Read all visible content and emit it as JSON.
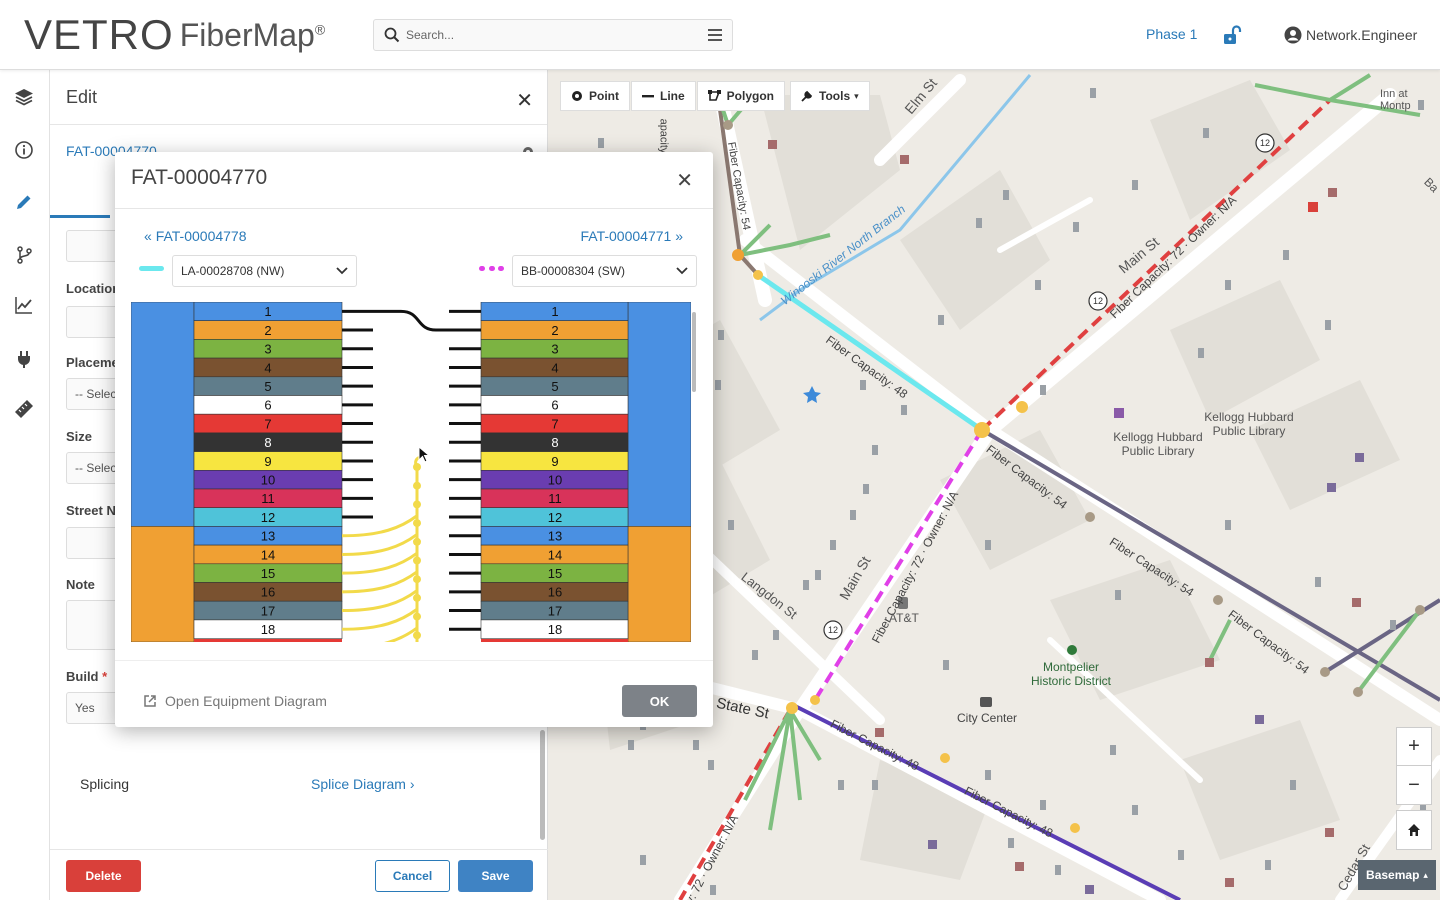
{
  "header": {
    "logo_main": "VETRO",
    "logo_product": "FiberMap",
    "logo_reg": "®",
    "search_placeholder": "Search...",
    "phase": "Phase 1",
    "user": "Network.Engineer"
  },
  "edit_panel": {
    "title": "Edit",
    "feature_id": "FAT-00004770",
    "labels": {
      "location": "Location",
      "placement": "Placeme",
      "size": "Size",
      "street": "Street N",
      "note": "Note",
      "build": "Build"
    },
    "placement_value": "-- Selec",
    "size_value": "-- Selec",
    "build_value": "Yes",
    "splicing_label": "Splicing",
    "splice_diagram_link": "Splice Diagram",
    "buttons": {
      "delete": "Delete",
      "cancel": "Cancel",
      "save": "Save"
    }
  },
  "map_tools": {
    "point": "Point",
    "line": "Line",
    "polygon": "Polygon",
    "tools": "Tools"
  },
  "map_labels": {
    "elm": "Elm St",
    "main_top": "Main St",
    "main_bottom": "Main St",
    "langdon": "Langdon St",
    "state": "State St",
    "cedar": "Cedar St",
    "river": "Winooski River North Branch",
    "fc48_a": "Fiber Capacity: 48",
    "fc48_b": "Fiber Capacity: 48",
    "fc48_c": "Fiber Capacity: 48",
    "fc54_a": "Fiber Capacity: 54",
    "fc54_b": "Fiber Capacity: 54",
    "fc54_c": "Fiber Capacity: 54",
    "fc72_top": "Fiber Capacity: 72 · Owner: N/A",
    "fc72_mid": "Fiber Capacity: 72 · Owner: N/A",
    "fc72_bot": "ity: 72 · Owner: N/A",
    "fc_vert": "Fiber Capacity: 54",
    "capacity_top": "apacity",
    "library1": "Kellogg Hubbard Public Library",
    "library2": "Kellogg Hubbard Public Library",
    "inn": "Inn at Montp",
    "att": "AT&T",
    "historic": "Montpelier Historic District",
    "city_center": "City Center",
    "route": "12",
    "ba": "Ba"
  },
  "zoom": {
    "in": "+",
    "out": "−"
  },
  "basemap": "Basemap",
  "modal": {
    "title": "FAT-00004770",
    "prev": "FAT-00004778",
    "next": "FAT-00004771",
    "left_cable": "LA-00028708 (NW)",
    "right_cable": "BB-00008304 (SW)",
    "left_cable_color": "#6be8ee",
    "right_cable_color": "#e040e8",
    "open_diagram": "Open Equipment Diagram",
    "ok": "OK",
    "fibers": [
      {
        "n": "1",
        "color": "#4a90e2"
      },
      {
        "n": "2",
        "color": "#f0a033"
      },
      {
        "n": "3",
        "color": "#7cb342"
      },
      {
        "n": "4",
        "color": "#7a5230"
      },
      {
        "n": "5",
        "color": "#607d8b"
      },
      {
        "n": "6",
        "color": "#ffffff"
      },
      {
        "n": "7",
        "color": "#e53935"
      },
      {
        "n": "8",
        "color": "#333333"
      },
      {
        "n": "9",
        "color": "#f7e540"
      },
      {
        "n": "10",
        "color": "#6a3db0"
      },
      {
        "n": "11",
        "color": "#d8335a"
      },
      {
        "n": "12",
        "color": "#4fc3d9"
      },
      {
        "n": "13",
        "color": "#4a90e2"
      },
      {
        "n": "14",
        "color": "#f0a033"
      },
      {
        "n": "15",
        "color": "#7cb342"
      },
      {
        "n": "16",
        "color": "#7a5230"
      },
      {
        "n": "17",
        "color": "#607d8b"
      },
      {
        "n": "18",
        "color": "#ffffff"
      }
    ],
    "tubes": [
      {
        "name": "tube-blue",
        "color": "#4a90e2"
      },
      {
        "name": "tube-orange",
        "color": "#f0a033"
      }
    ]
  },
  "colors": {
    "accent": "#2a7ab8",
    "delete": "#d9403a",
    "save": "#3f83c4"
  }
}
